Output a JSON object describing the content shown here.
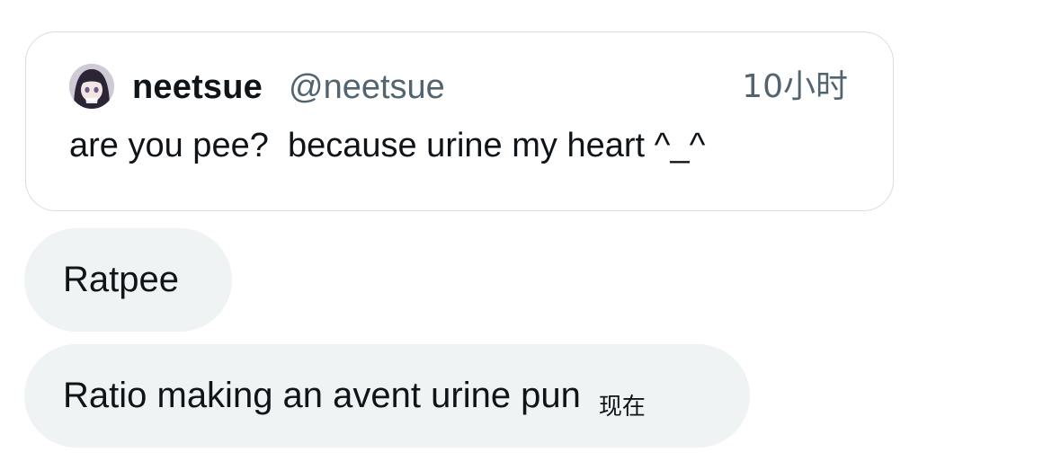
{
  "quoted_post": {
    "display_name": "neetsue",
    "handle": "@neetsue",
    "timestamp": "10小时",
    "text": "are you pee?  because urine my heart ^_^",
    "avatar": "profile-avatar-anime-girl"
  },
  "messages": [
    {
      "text": "Ratpee"
    },
    {
      "text": "Ratio making an avent urine pun",
      "time": "现在"
    }
  ],
  "colors": {
    "bubble_bg": "#eff3f4",
    "card_border": "#d9dde1",
    "secondary_text": "#536471",
    "primary_text": "#0f1419"
  }
}
